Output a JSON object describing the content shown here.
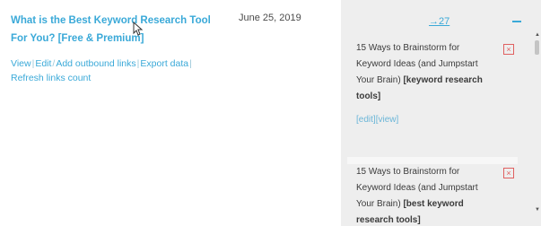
{
  "post": {
    "title": "What is the Best Keyword Research Tool For You? [Free & Premium]",
    "date": "June 25, 2019",
    "actions": [
      "View",
      "Edit",
      "Add outbound links",
      "Export data"
    ],
    "refresh": "Refresh links count"
  },
  "panel": {
    "pager_label": "→27",
    "cards": [
      {
        "text": "15 Ways to Brainstorm for Keyword Ideas (and Jumpstart Your Brain)",
        "keyword": "[keyword research tools]",
        "edit_label": "[edit]",
        "view_label": "[view]"
      },
      {
        "text": "15 Ways to Brainstorm for Keyword Ideas (and Jumpstart Your Brain)",
        "keyword": "[best keyword research tools]"
      }
    ],
    "close_glyph": "×"
  },
  "colors": {
    "link": "#3aa9d8",
    "panel_bg": "#eeeeee",
    "close": "#e06060"
  }
}
